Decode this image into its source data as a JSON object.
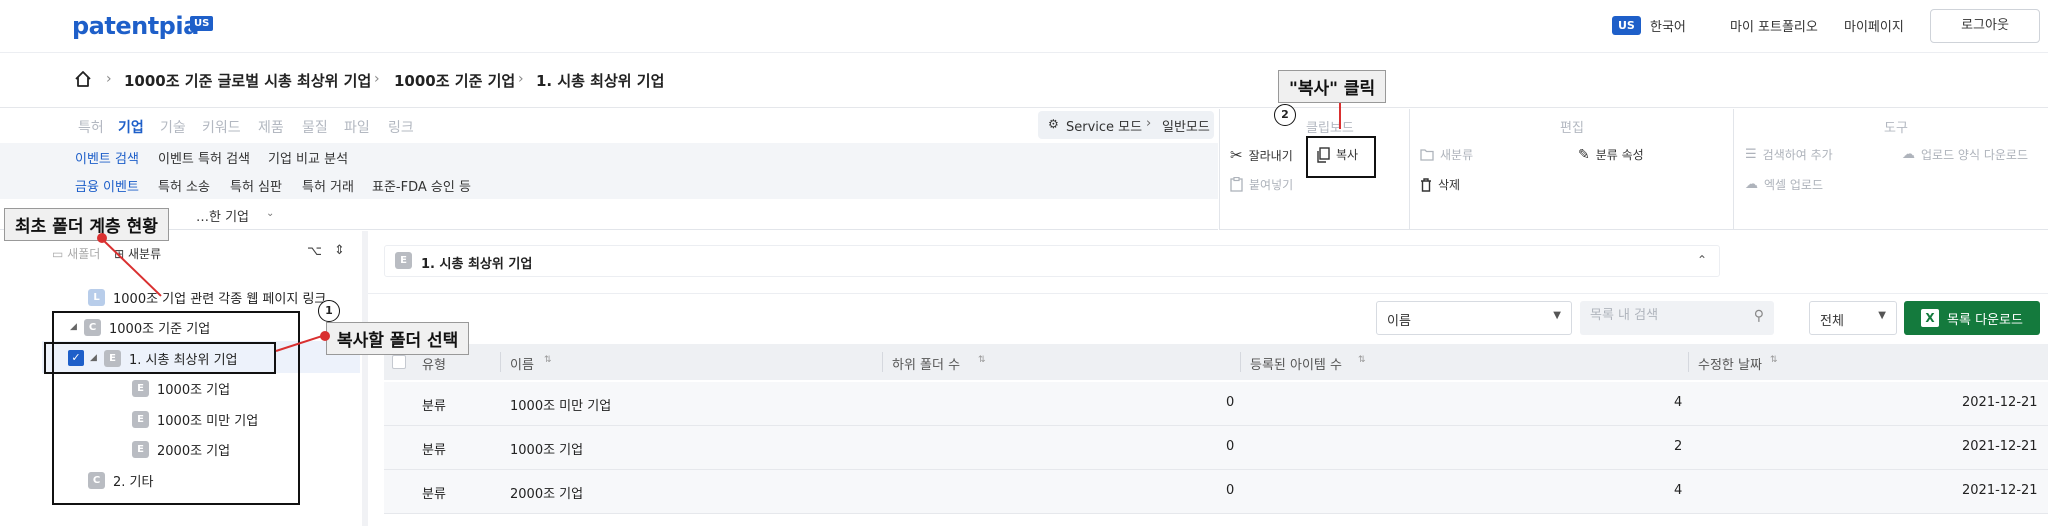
{
  "header": {
    "logo": "patentpia",
    "logo_badge": "US",
    "lang_badge": "US",
    "lang_label": "한국어",
    "portfolio": "마이 포트폴리오",
    "mypage": "마이페이지",
    "logout": "로그아웃"
  },
  "breadcrumb": [
    "1000조 기준 글로벌 시총 최상위 기업",
    "1000조 기준 기업",
    "1. 시총 최상위 기업"
  ],
  "tabs": [
    "특허",
    "기업",
    "기술",
    "키워드",
    "제품",
    "물질",
    "파일",
    "링크"
  ],
  "mode": {
    "service": "Service 모드",
    "normal": "일반모드"
  },
  "subrow1": [
    "이벤트 검색",
    "이벤트 특허 검색",
    "기업 비교 분석"
  ],
  "subrow2": [
    "금융 이벤트",
    "특허 소송",
    "특허 심판",
    "특허 거래",
    "표준-FDA 승인 등"
  ],
  "subrow3": "…한 기업",
  "toolbar": {
    "clipboard_title": "클립보드",
    "edit_title": "편집",
    "tools_title": "도구",
    "cut": "잘라내기",
    "copy": "복사",
    "paste": "붙여넣기",
    "new_category": "새분류",
    "category_props": "분류 속성",
    "delete": "삭제",
    "search_add": "검색하여 추가",
    "upload_template": "업로드 양식 다운로드",
    "excel_upload": "엑셀 업로드"
  },
  "tree": {
    "new_folder": "새폴더",
    "new_category": "새분류",
    "items": [
      {
        "badge": "L",
        "label": "1000조 기업 관련 각종 웹 페이지 링크"
      },
      {
        "badge": "C",
        "label": "1000조 기준 기업"
      },
      {
        "badge": "E",
        "label": "1. 시총 최상위 기업"
      },
      {
        "badge": "E",
        "label": "1000조 기업"
      },
      {
        "badge": "E",
        "label": "1000조 미만 기업"
      },
      {
        "badge": "E",
        "label": "2000조 기업"
      },
      {
        "badge": "C",
        "label": "2. 기타"
      }
    ]
  },
  "content": {
    "folder_title": "1. 시총 최상위 기업",
    "sort_select": "이름",
    "search_placeholder": "목록 내 검색",
    "filter_select": "전체",
    "download": "목록 다운로드",
    "columns": [
      "유형",
      "이름",
      "하위 폴더 수",
      "등록된 아이템 수",
      "수정한 날짜"
    ],
    "rows": [
      {
        "type": "분류",
        "name": "1000조 미만 기업",
        "subfolders": "0",
        "items": "4",
        "date": "2021-12-21"
      },
      {
        "type": "분류",
        "name": "1000조 기업",
        "subfolders": "0",
        "items": "2",
        "date": "2021-12-21"
      },
      {
        "type": "분류",
        "name": "2000조 기업",
        "subfolders": "0",
        "items": "4",
        "date": "2021-12-21"
      }
    ]
  },
  "annotations": {
    "copy_click": "\"복사\" 클릭",
    "tree_status": "최초 폴더 계층 현황",
    "select_folder": "복사할 폴더 선택",
    "step1": "1",
    "step2": "2"
  },
  "colors": {
    "accent": "#1e5fc9",
    "download": "#147a3d",
    "annotation": "#d93030"
  }
}
